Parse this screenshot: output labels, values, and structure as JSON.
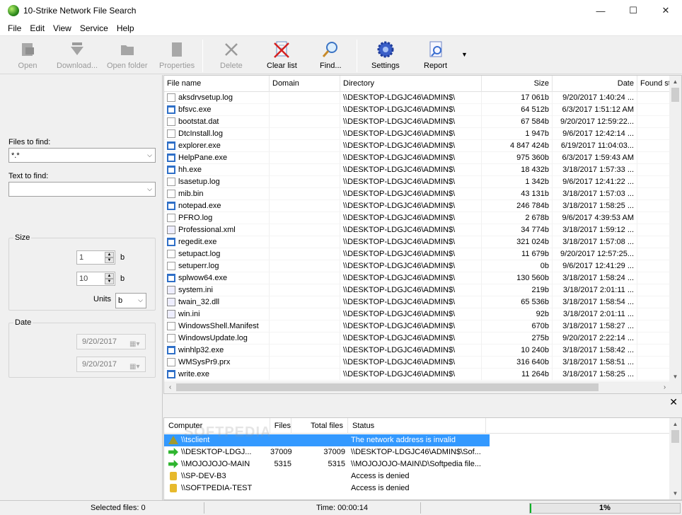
{
  "window": {
    "title": "10-Strike Network File Search",
    "minimize": "—",
    "maximize": "☐",
    "close": "✕"
  },
  "menu": [
    "File",
    "Edit",
    "View",
    "Service",
    "Help"
  ],
  "toolbar": {
    "open": "Open",
    "download": "Download...",
    "open_folder": "Open folder",
    "properties": "Properties",
    "delete": "Delete",
    "clear_list": "Clear list",
    "find": "Find...",
    "settings": "Settings",
    "report": "Report"
  },
  "search": {
    "files_label": "Files to find:",
    "files_value": "*.*",
    "text_label": "Text to find:",
    "text_value": "",
    "size_group": "Size",
    "size_min": "1",
    "size_max": "10",
    "size_unit_min": "b",
    "size_unit_max": "b",
    "units_label": "Units",
    "units_value": "b",
    "date_group": "Date",
    "date_from": "9/20/2017",
    "date_to": "9/20/2017"
  },
  "filelist": {
    "columns": [
      "File name",
      "Domain",
      "Directory",
      "Size",
      "Date",
      "Found st"
    ],
    "rows": [
      {
        "name": "aksdrvsetup.log",
        "icon": "doc",
        "dir": "\\\\DESKTOP-LDGJC46\\ADMIN$\\",
        "size": "17 061b",
        "date": "9/20/2017 1:40:24 ..."
      },
      {
        "name": "bfsvc.exe",
        "icon": "exe",
        "dir": "\\\\DESKTOP-LDGJC46\\ADMIN$\\",
        "size": "64 512b",
        "date": "6/3/2017 1:51:12 AM"
      },
      {
        "name": "bootstat.dat",
        "icon": "doc",
        "dir": "\\\\DESKTOP-LDGJC46\\ADMIN$\\",
        "size": "67 584b",
        "date": "9/20/2017 12:59:22..."
      },
      {
        "name": "DtcInstall.log",
        "icon": "doc",
        "dir": "\\\\DESKTOP-LDGJC46\\ADMIN$\\",
        "size": "1 947b",
        "date": "9/6/2017 12:42:14 ..."
      },
      {
        "name": "explorer.exe",
        "icon": "exe",
        "dir": "\\\\DESKTOP-LDGJC46\\ADMIN$\\",
        "size": "4 847 424b",
        "date": "6/19/2017 11:04:03..."
      },
      {
        "name": "HelpPane.exe",
        "icon": "exe",
        "dir": "\\\\DESKTOP-LDGJC46\\ADMIN$\\",
        "size": "975 360b",
        "date": "6/3/2017 1:59:43 AM"
      },
      {
        "name": "hh.exe",
        "icon": "exe",
        "dir": "\\\\DESKTOP-LDGJC46\\ADMIN$\\",
        "size": "18 432b",
        "date": "3/18/2017 1:57:33 ..."
      },
      {
        "name": "lsasetup.log",
        "icon": "doc",
        "dir": "\\\\DESKTOP-LDGJC46\\ADMIN$\\",
        "size": "1 342b",
        "date": "9/6/2017 12:41:22 ..."
      },
      {
        "name": "mib.bin",
        "icon": "doc",
        "dir": "\\\\DESKTOP-LDGJC46\\ADMIN$\\",
        "size": "43 131b",
        "date": "3/18/2017 1:57:03 ..."
      },
      {
        "name": "notepad.exe",
        "icon": "exe",
        "dir": "\\\\DESKTOP-LDGJC46\\ADMIN$\\",
        "size": "246 784b",
        "date": "3/18/2017 1:58:25 ..."
      },
      {
        "name": "PFRO.log",
        "icon": "doc",
        "dir": "\\\\DESKTOP-LDGJC46\\ADMIN$\\",
        "size": "2 678b",
        "date": "9/6/2017 4:39:53 AM"
      },
      {
        "name": "Professional.xml",
        "icon": "cfg",
        "dir": "\\\\DESKTOP-LDGJC46\\ADMIN$\\",
        "size": "34 774b",
        "date": "3/18/2017 1:59:12 ..."
      },
      {
        "name": "regedit.exe",
        "icon": "exe",
        "dir": "\\\\DESKTOP-LDGJC46\\ADMIN$\\",
        "size": "321 024b",
        "date": "3/18/2017 1:57:08 ..."
      },
      {
        "name": "setupact.log",
        "icon": "doc",
        "dir": "\\\\DESKTOP-LDGJC46\\ADMIN$\\",
        "size": "11 679b",
        "date": "9/20/2017 12:57:25..."
      },
      {
        "name": "setuperr.log",
        "icon": "doc",
        "dir": "\\\\DESKTOP-LDGJC46\\ADMIN$\\",
        "size": "0b",
        "date": "9/6/2017 12:41:29 ..."
      },
      {
        "name": "splwow64.exe",
        "icon": "exe",
        "dir": "\\\\DESKTOP-LDGJC46\\ADMIN$\\",
        "size": "130 560b",
        "date": "3/18/2017 1:58:24 ..."
      },
      {
        "name": "system.ini",
        "icon": "cfg",
        "dir": "\\\\DESKTOP-LDGJC46\\ADMIN$\\",
        "size": "219b",
        "date": "3/18/2017 2:01:11 ..."
      },
      {
        "name": "twain_32.dll",
        "icon": "cfg",
        "dir": "\\\\DESKTOP-LDGJC46\\ADMIN$\\",
        "size": "65 536b",
        "date": "3/18/2017 1:58:54 ..."
      },
      {
        "name": "win.ini",
        "icon": "cfg",
        "dir": "\\\\DESKTOP-LDGJC46\\ADMIN$\\",
        "size": "92b",
        "date": "3/18/2017 2:01:11 ..."
      },
      {
        "name": "WindowsShell.Manifest",
        "icon": "doc",
        "dir": "\\\\DESKTOP-LDGJC46\\ADMIN$\\",
        "size": "670b",
        "date": "3/18/2017 1:58:27 ..."
      },
      {
        "name": "WindowsUpdate.log",
        "icon": "doc",
        "dir": "\\\\DESKTOP-LDGJC46\\ADMIN$\\",
        "size": "275b",
        "date": "9/20/2017 2:22:14 ..."
      },
      {
        "name": "winhlp32.exe",
        "icon": "exe",
        "dir": "\\\\DESKTOP-LDGJC46\\ADMIN$\\",
        "size": "10 240b",
        "date": "3/18/2017 1:58:42 ..."
      },
      {
        "name": "WMSysPr9.prx",
        "icon": "doc",
        "dir": "\\\\DESKTOP-LDGJC46\\ADMIN$\\",
        "size": "316 640b",
        "date": "3/18/2017 1:58:51 ..."
      },
      {
        "name": "write.exe",
        "icon": "exe",
        "dir": "\\\\DESKTOP-LDGJC46\\ADMIN$\\",
        "size": "11 264b",
        "date": "3/18/2017 1:58:25 ..."
      }
    ]
  },
  "computers": {
    "columns": [
      "Computer",
      "Files",
      "Total files",
      "Status"
    ],
    "rows": [
      {
        "icon": "warn",
        "name": "\\\\tsclient",
        "files": "",
        "total": "",
        "status": "The network address is invalid",
        "selected": true
      },
      {
        "icon": "ok",
        "name": "\\\\DESKTOP-LDGJ...",
        "files": "37009",
        "total": "37009",
        "status": "\\\\DESKTOP-LDGJC46\\ADMIN$\\Sof...",
        "selected": false
      },
      {
        "icon": "ok",
        "name": "\\\\MOJOJOJO-MAIN",
        "files": "5315",
        "total": "5315",
        "status": "\\\\MOJOJOJO-MAIN\\D\\Softpedia file...",
        "selected": false
      },
      {
        "icon": "lock",
        "name": "\\\\SP-DEV-B3",
        "files": "",
        "total": "",
        "status": "Access is denied",
        "selected": false
      },
      {
        "icon": "lock",
        "name": "\\\\SOFTPEDIA-TEST",
        "files": "",
        "total": "",
        "status": "Access is denied",
        "selected": false
      }
    ]
  },
  "watermark": "SOFTPEDIA",
  "statusbar": {
    "selected": "Selected files: 0",
    "time": "Time: 00:00:14",
    "progress_text": "1%",
    "progress": 0.01
  }
}
